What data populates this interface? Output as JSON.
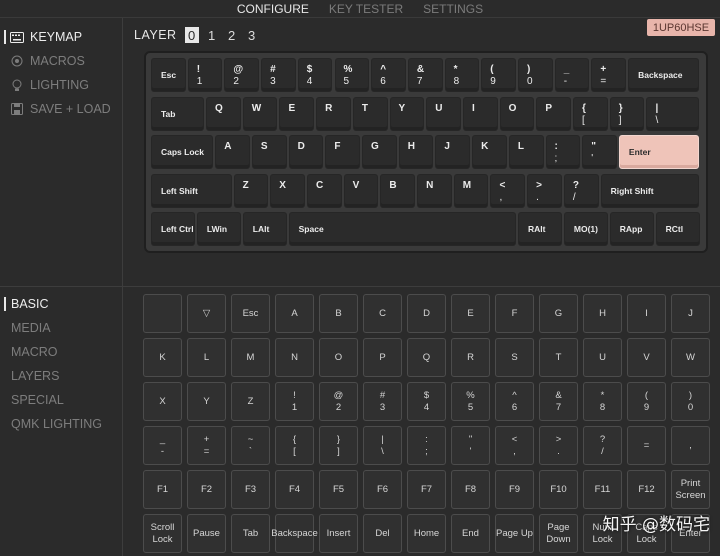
{
  "topnav": [
    {
      "label": "CONFIGURE",
      "active": true
    },
    {
      "label": "KEY TESTER",
      "active": false
    },
    {
      "label": "SETTINGS",
      "active": false
    }
  ],
  "menu": [
    {
      "label": "KEYMAP",
      "icon": "keyboard-icon",
      "active": true
    },
    {
      "label": "MACROS",
      "icon": "target-icon",
      "active": false
    },
    {
      "label": "LIGHTING",
      "icon": "bulb-icon",
      "active": false
    },
    {
      "label": "SAVE + LOAD",
      "icon": "save-icon",
      "active": false
    }
  ],
  "layer": {
    "label": "LAYER",
    "options": [
      "0",
      "1",
      "2",
      "3"
    ],
    "selected": "0"
  },
  "device_badge": "1UP60HSE",
  "keyboard": {
    "rows": [
      [
        {
          "t1": "Esc"
        },
        {
          "t1": "!",
          "t2": "1"
        },
        {
          "t1": "@",
          "t2": "2"
        },
        {
          "t1": "#",
          "t2": "3"
        },
        {
          "t1": "$",
          "t2": "4"
        },
        {
          "t1": "%",
          "t2": "5"
        },
        {
          "t1": "^",
          "t2": "6"
        },
        {
          "t1": "&",
          "t2": "7"
        },
        {
          "t1": "*",
          "t2": "8"
        },
        {
          "t1": "(",
          "t2": "9"
        },
        {
          "t1": ")",
          "t2": "0"
        },
        {
          "t1": "_",
          "t2": "-"
        },
        {
          "t1": "+",
          "t2": "="
        },
        {
          "t1": "Backspace"
        }
      ],
      [
        {
          "t1": "Tab"
        },
        {
          "t1": "Q"
        },
        {
          "t1": "W"
        },
        {
          "t1": "E"
        },
        {
          "t1": "R"
        },
        {
          "t1": "T"
        },
        {
          "t1": "Y"
        },
        {
          "t1": "U"
        },
        {
          "t1": "I"
        },
        {
          "t1": "O"
        },
        {
          "t1": "P"
        },
        {
          "t1": "{",
          "t2": "["
        },
        {
          "t1": "}",
          "t2": "]"
        },
        {
          "t1": "|",
          "t2": "\\"
        }
      ],
      [
        {
          "t1": "Caps Lock"
        },
        {
          "t1": "A"
        },
        {
          "t1": "S"
        },
        {
          "t1": "D"
        },
        {
          "t1": "F"
        },
        {
          "t1": "G"
        },
        {
          "t1": "H"
        },
        {
          "t1": "J"
        },
        {
          "t1": "K"
        },
        {
          "t1": "L"
        },
        {
          "t1": ":",
          "t2": ";"
        },
        {
          "t1": "\"",
          "t2": "'"
        },
        {
          "t1": "Enter",
          "accent": true
        }
      ],
      [
        {
          "t1": "Left Shift"
        },
        {
          "t1": "Z"
        },
        {
          "t1": "X"
        },
        {
          "t1": "C"
        },
        {
          "t1": "V"
        },
        {
          "t1": "B"
        },
        {
          "t1": "N"
        },
        {
          "t1": "M"
        },
        {
          "t1": "<",
          "t2": ","
        },
        {
          "t1": ">",
          "t2": "."
        },
        {
          "t1": "?",
          "t2": "/"
        },
        {
          "t1": "Right Shift"
        }
      ],
      [
        {
          "t1": "Left Ctrl"
        },
        {
          "t1": "LWin"
        },
        {
          "t1": "LAlt"
        },
        {
          "t1": "Space"
        },
        {
          "t1": "RAlt"
        },
        {
          "t1": "MO(1)"
        },
        {
          "t1": "RApp"
        },
        {
          "t1": "RCtl"
        }
      ]
    ]
  },
  "categories": [
    {
      "label": "BASIC",
      "active": true
    },
    {
      "label": "MEDIA",
      "active": false
    },
    {
      "label": "MACRO",
      "active": false
    },
    {
      "label": "LAYERS",
      "active": false
    },
    {
      "label": "SPECIAL",
      "active": false
    },
    {
      "label": "QMK LIGHTING",
      "active": false
    }
  ],
  "keycodes": [
    [
      "",
      "▽",
      "Esc",
      "A",
      "B",
      "C",
      "D",
      "E",
      "F",
      "G",
      "H",
      "I",
      "J"
    ],
    [
      "K",
      "L",
      "M",
      "N",
      "O",
      "P",
      "Q",
      "R",
      "S",
      "T",
      "U",
      "V",
      "W"
    ],
    [
      "X",
      "Y",
      "Z",
      "!\n1",
      "@\n2",
      "#\n3",
      "$\n4",
      "%\n5",
      "^\n6",
      "&\n7",
      "*\n8",
      "(\n9",
      ")\n0"
    ],
    [
      "_\n-",
      "+\n=",
      "~\n`",
      "{\n[",
      "}\n]",
      "|\n\\",
      ":\n;",
      "\"\n'",
      "<\n,",
      ">\n.",
      "?\n/",
      "=",
      ","
    ],
    [
      "F1",
      "F2",
      "F3",
      "F4",
      "F5",
      "F6",
      "F7",
      "F8",
      "F9",
      "F10",
      "F11",
      "F12",
      "Print\nScreen"
    ],
    [
      "Scroll\nLock",
      "Pause",
      "Tab",
      "Backspace",
      "Insert",
      "Del",
      "Home",
      "End",
      "Page Up",
      "Page\nDown",
      "Num\nLock",
      "Caps\nLock",
      "Enter"
    ]
  ],
  "watermark": "知乎 @数码宅",
  "colors": {
    "accent": "#efc4b9",
    "badge": "#e8b5ab",
    "bg": "#2b2b2b"
  }
}
